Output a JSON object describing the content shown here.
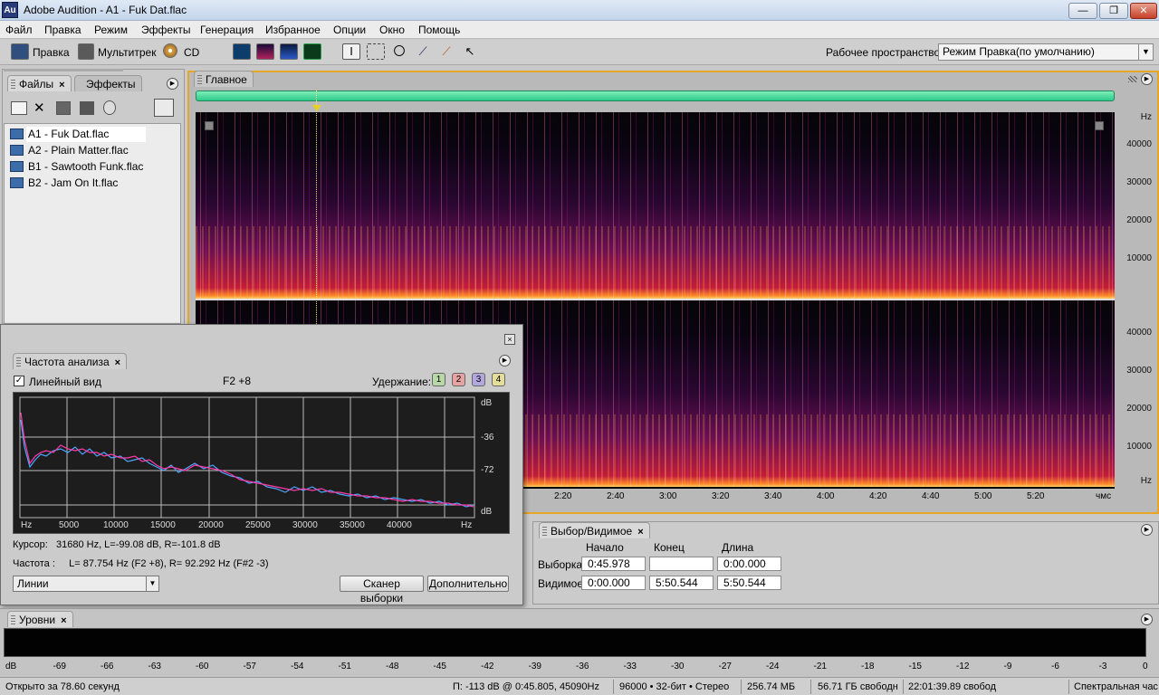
{
  "window": {
    "app_icon": "Au",
    "title": "Adobe Audition - A1 - Fuk Dat.flac",
    "min": "—",
    "max": "❐",
    "close": "✕"
  },
  "menu": [
    "Файл",
    "Правка",
    "Режим",
    "Эффекты",
    "Генерация",
    "Избранное",
    "Опции",
    "Окно",
    "Помощь"
  ],
  "toolbar": {
    "edit": "Правка",
    "multitrack": "Мультитрек",
    "cd": "CD",
    "workspace_label": "Рабочее пространство:",
    "workspace_value": "Режим Правка(по умолчанию)"
  },
  "files_panel": {
    "tabs": [
      "Файлы",
      "Эффекты"
    ],
    "files": [
      "A1 - Fuk Dat.flac",
      "A2 - Plain Matter.flac",
      "B1 - Sawtooth Funk.flac",
      "B2 - Jam On It.flac"
    ]
  },
  "editor": {
    "tab": "Главное",
    "hz_labels_top": [
      "Hz",
      "40000",
      "30000",
      "20000",
      "10000"
    ],
    "hz_labels_bottom": [
      "40000",
      "30000",
      "20000",
      "10000",
      "Hz"
    ],
    "time_labels": [
      "2:20",
      "2:40",
      "3:00",
      "3:20",
      "3:40",
      "4:00",
      "4:20",
      "4:40",
      "5:00",
      "5:20",
      "чмс"
    ],
    "colors": {
      "accent": "#e7a627",
      "overview": "#3fd894"
    }
  },
  "freq_analysis": {
    "tab": "Частота анализа",
    "linear_view": "Линейный вид",
    "linear_checked": true,
    "note": "F2 +8",
    "hold_label": "Удержание:",
    "hold_buttons": [
      "1",
      "2",
      "3",
      "4"
    ],
    "y_labels": [
      "dB",
      "-36",
      "-72",
      "dB"
    ],
    "x_labels": [
      "Hz",
      "5000",
      "10000",
      "15000",
      "20000",
      "25000",
      "30000",
      "35000",
      "40000",
      "Hz"
    ],
    "cursor": "Курсор:   31680 Hz, L=-99.08 dB, R=-101.8 dB",
    "frequency": "Частота :     L= 87.754 Hz (F2 +8), R= 92.292 Hz (F#2 -3)",
    "mode": "Линии",
    "scan_button": "Сканер выборки",
    "more_button": "Дополнительно"
  },
  "selection": {
    "tab": "Выбор/Видимое",
    "headers": [
      "Начало",
      "Конец",
      "Длина"
    ],
    "rows": [
      {
        "label": "Выборка",
        "start": "0:45.978",
        "end": "",
        "length": "0:00.000"
      },
      {
        "label": "Видимое",
        "start": "0:00.000",
        "end": "5:50.544",
        "length": "5:50.544"
      }
    ]
  },
  "levels": {
    "tab": "Уровни",
    "scale": [
      "dB",
      "-69",
      "-66",
      "-63",
      "-60",
      "-57",
      "-54",
      "-51",
      "-48",
      "-45",
      "-42",
      "-39",
      "-36",
      "-33",
      "-30",
      "-27",
      "-24",
      "-21",
      "-18",
      "-15",
      "-12",
      "-9",
      "-6",
      "-3",
      "0"
    ]
  },
  "status": {
    "opened": "Открыто за 78.60 секунд",
    "cursor": "П: -113 dB @  0:45.805, 45090Hz",
    "format": "96000 • 32-бит • Стерео",
    "size": "256.74 МБ",
    "disk": "56.71 ГБ свободн",
    "time_free": "22:01:39.89 свобод",
    "view": "Спектральная час"
  }
}
